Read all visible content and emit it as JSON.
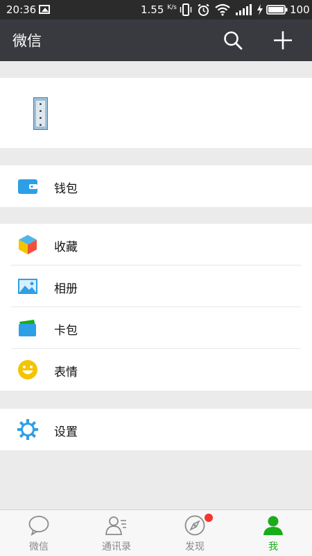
{
  "status_bar": {
    "time": "20:36",
    "speed": "1.55",
    "speed_unit": "K/s",
    "battery": "100"
  },
  "header": {
    "title": "微信",
    "icons": [
      "search-icon",
      "plus-icon"
    ]
  },
  "profile": {
    "avatar_icon": "avatar"
  },
  "menu": {
    "wallet": "钱包",
    "favorites": "收藏",
    "album": "相册",
    "cards": "卡包",
    "stickers": "表情",
    "settings": "设置"
  },
  "tabs": [
    {
      "label": "微信",
      "icon": "chat-icon"
    },
    {
      "label": "通讯录",
      "icon": "contacts-icon"
    },
    {
      "label": "发现",
      "icon": "compass-icon"
    },
    {
      "label": "我",
      "icon": "person-icon",
      "active": true
    }
  ],
  "colors": {
    "title_bar": "#393a3f",
    "status_bar": "#2b2b2b",
    "active_tab": "#1aad19",
    "badge": "#f43530",
    "icon_blue": "#2d9fe6",
    "sticker_yellow": "#f5c400"
  }
}
